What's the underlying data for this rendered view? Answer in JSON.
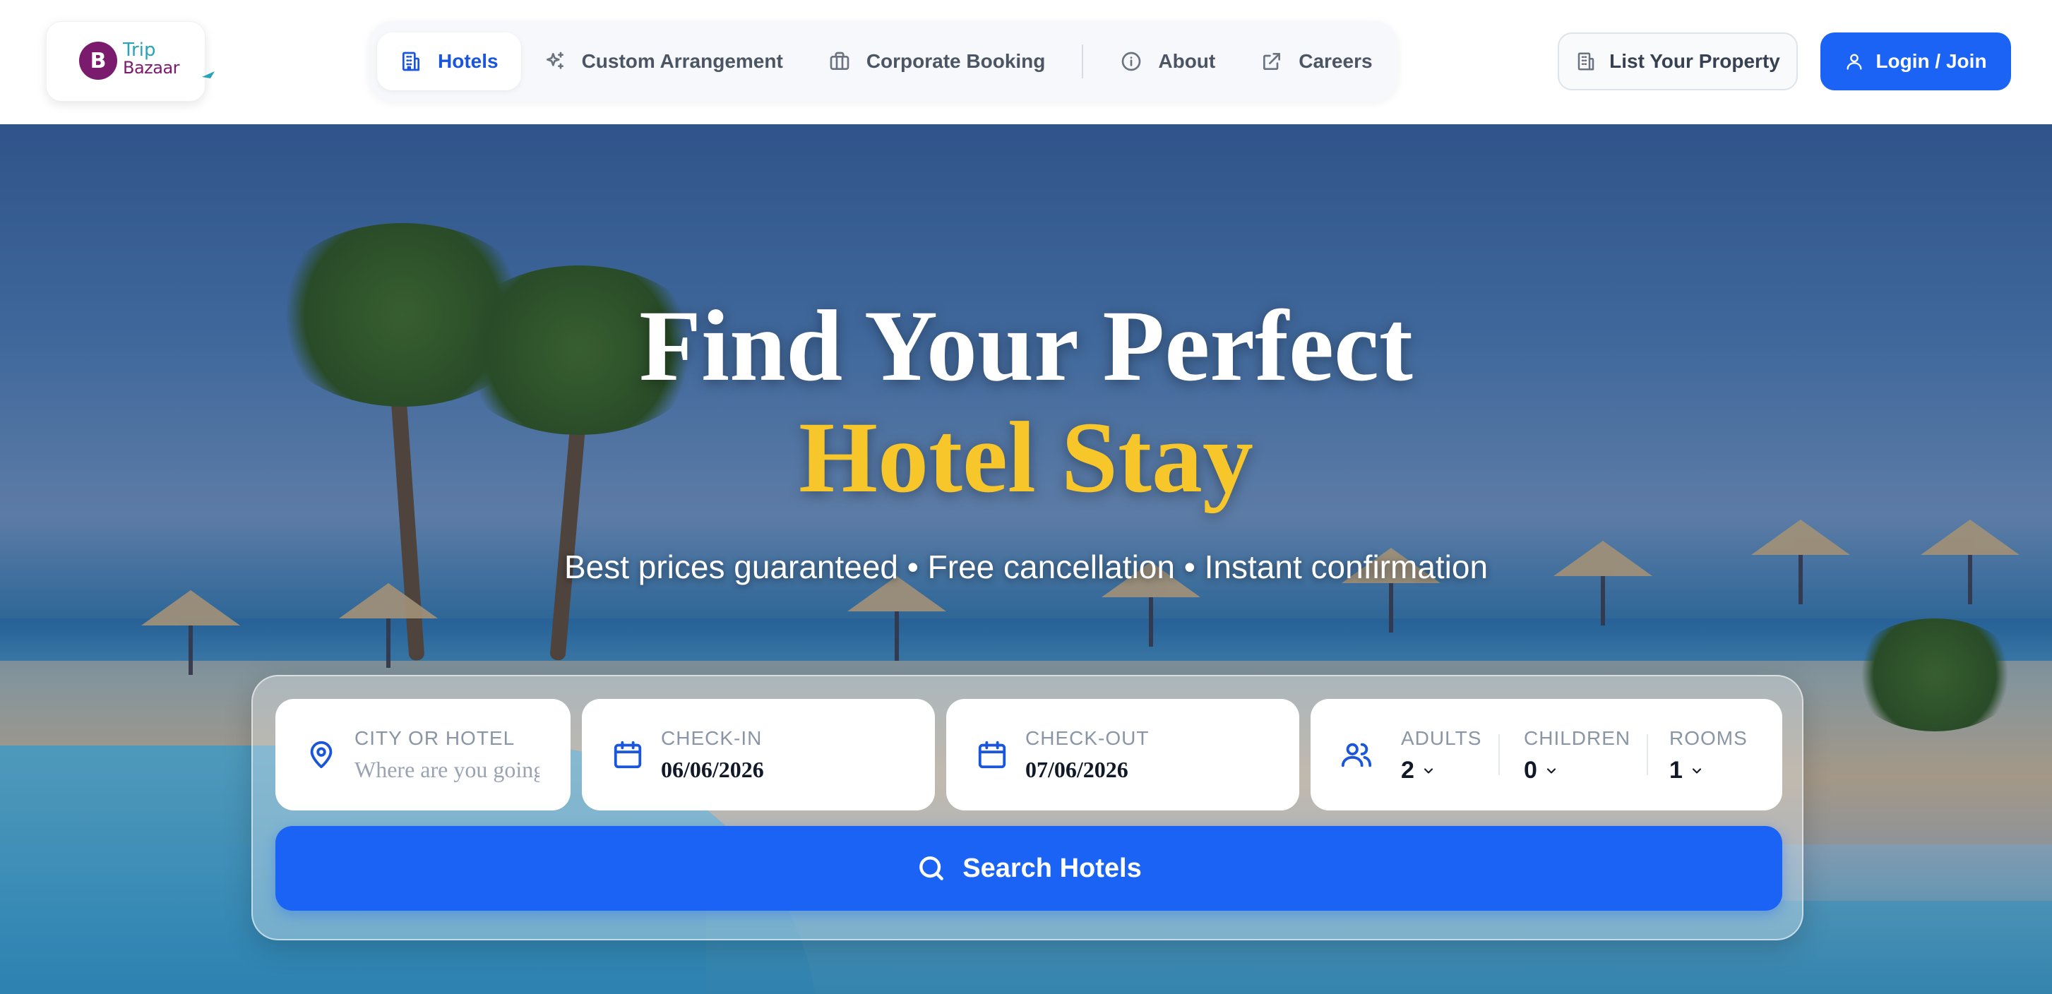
{
  "brand": {
    "line1": "Trip",
    "line2": "Bazaar",
    "badge_letter": "B"
  },
  "nav": {
    "items": [
      {
        "label": "Hotels",
        "icon": "building-icon",
        "active": true
      },
      {
        "label": "Custom Arrangement",
        "icon": "sparkles-icon",
        "active": false
      },
      {
        "label": "Corporate Booking",
        "icon": "briefcase-icon",
        "active": false
      },
      {
        "label": "About",
        "icon": "info-icon",
        "active": false
      },
      {
        "label": "Careers",
        "icon": "external-link-icon",
        "active": false
      }
    ]
  },
  "actions": {
    "list_property": "List Your Property",
    "login": "Login / Join"
  },
  "hero": {
    "title_line1": "Find Your Perfect",
    "title_line2": "Hotel Stay",
    "subtitle": "Best prices guaranteed • Free cancellation • Instant confirmation"
  },
  "search": {
    "city": {
      "label": "CITY OR HOTEL",
      "placeholder": "Where are you going?",
      "value": ""
    },
    "checkin": {
      "label": "CHECK-IN",
      "value": "06/06/2026"
    },
    "checkout": {
      "label": "CHECK-OUT",
      "value": "07/06/2026"
    },
    "adults": {
      "label": "ADULTS",
      "value": "2"
    },
    "children": {
      "label": "CHILDREN",
      "value": "0"
    },
    "rooms": {
      "label": "ROOMS",
      "value": "1"
    },
    "button": "Search Hotels"
  },
  "colors": {
    "primary": "#1a63f5",
    "accent_gold": "#f6c62a",
    "brand_purple": "#7a1b6e",
    "brand_teal": "#27a4b7"
  }
}
